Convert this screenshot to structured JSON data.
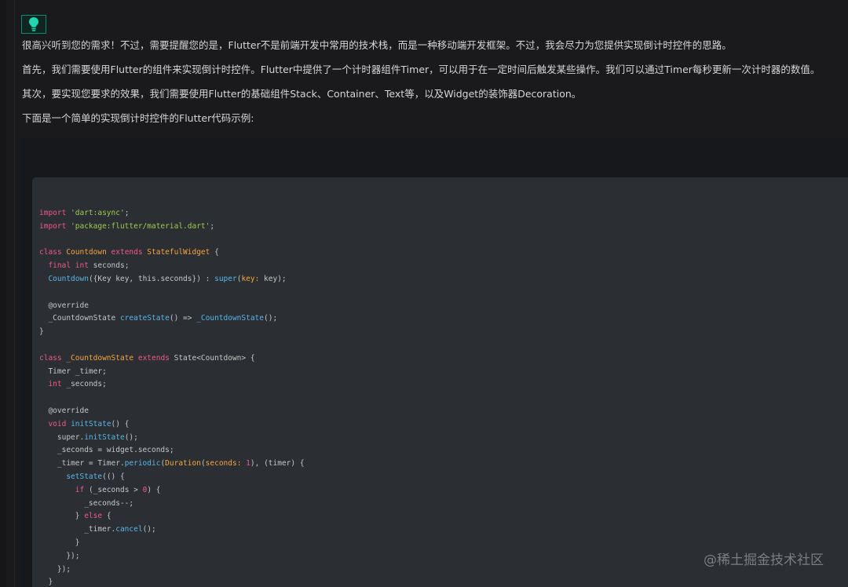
{
  "avatar": {
    "icon": "lightbulb-icon",
    "accent": "#1fd6b0"
  },
  "message": {
    "paragraphs": [
      "很高兴听到您的需求！不过，需要提醒您的是，Flutter不是前端开发中常用的技术栈，而是一种移动端开发框架。不过，我会尽力为您提供实现倒计时控件的思路。",
      "首先，我们需要使用Flutter的组件来实现倒计时控件。Flutter中提供了一个计时器组件Timer，可以用于在一定时间后触发某些操作。我们可以通过Timer每秒更新一次计时器的数值。",
      "其次，要实现您要求的效果，我们需要使用Flutter的基础组件Stack、Container、Text等，以及Widget的装饰器Decoration。",
      "下面是一个简单的实现倒计时控件的Flutter代码示例:"
    ]
  },
  "code": {
    "language": "dart",
    "lines": [
      [
        [
          "kw",
          "import "
        ],
        [
          "str",
          "'dart:async'"
        ],
        [
          "p",
          ";"
        ]
      ],
      [
        [
          "kw",
          "import "
        ],
        [
          "str",
          "'package:flutter/material.dart'"
        ],
        [
          "p",
          ";"
        ]
      ],
      [],
      [
        [
          "kw",
          "class "
        ],
        [
          "type",
          "Countdown "
        ],
        [
          "kw",
          "extends "
        ],
        [
          "type",
          "StatefulWidget"
        ],
        [
          "p",
          " {"
        ]
      ],
      [
        [
          "p",
          "  "
        ],
        [
          "kw",
          "final int"
        ],
        [
          "p",
          " seconds;"
        ]
      ],
      [
        [
          "p",
          "  "
        ],
        [
          "fn",
          "Countdown"
        ],
        [
          "p",
          "({Key key, this.seconds}) : "
        ],
        [
          "fn",
          "super"
        ],
        [
          "p",
          "("
        ],
        [
          "type",
          "key:"
        ],
        [
          "p",
          " key);"
        ]
      ],
      [],
      [
        [
          "p",
          "  @override"
        ]
      ],
      [
        [
          "p",
          "  _CountdownState "
        ],
        [
          "fn",
          "createState"
        ],
        [
          "p",
          "() => "
        ],
        [
          "fn",
          "_CountdownState"
        ],
        [
          "p",
          "();"
        ]
      ],
      [
        [
          "p",
          "}"
        ]
      ],
      [],
      [
        [
          "kw",
          "class "
        ],
        [
          "type",
          "_CountdownState "
        ],
        [
          "kw",
          "extends "
        ],
        [
          "p",
          "State<Countdown> {"
        ]
      ],
      [
        [
          "p",
          "  Timer _timer;"
        ]
      ],
      [
        [
          "p",
          "  "
        ],
        [
          "kw",
          "int"
        ],
        [
          "p",
          " _seconds;"
        ]
      ],
      [],
      [
        [
          "p",
          "  @override"
        ]
      ],
      [
        [
          "p",
          "  "
        ],
        [
          "kw",
          "void "
        ],
        [
          "fn",
          "initState"
        ],
        [
          "p",
          "() {"
        ]
      ],
      [
        [
          "p",
          "    super."
        ],
        [
          "fn",
          "initState"
        ],
        [
          "p",
          "();"
        ]
      ],
      [
        [
          "p",
          "    _seconds = widget.seconds;"
        ]
      ],
      [
        [
          "p",
          "    _timer = Timer."
        ],
        [
          "fn",
          "periodic"
        ],
        [
          "p",
          "("
        ],
        [
          "type",
          "Duration"
        ],
        [
          "p",
          "("
        ],
        [
          "type",
          "seconds:"
        ],
        [
          "p",
          " "
        ],
        [
          "num",
          "1"
        ],
        [
          "p",
          "), (timer) {"
        ]
      ],
      [
        [
          "p",
          "      "
        ],
        [
          "fn",
          "setState"
        ],
        [
          "p",
          "(() {"
        ]
      ],
      [
        [
          "p",
          "        "
        ],
        [
          "kw",
          "if"
        ],
        [
          "p",
          " (_seconds > "
        ],
        [
          "num",
          "0"
        ],
        [
          "p",
          ") {"
        ]
      ],
      [
        [
          "p",
          "          _seconds--;"
        ]
      ],
      [
        [
          "p",
          "        } "
        ],
        [
          "kw",
          "else"
        ],
        [
          "p",
          " {"
        ]
      ],
      [
        [
          "p",
          "          _timer."
        ],
        [
          "fn",
          "cancel"
        ],
        [
          "p",
          "();"
        ]
      ],
      [
        [
          "p",
          "        }"
        ]
      ],
      [
        [
          "p",
          "      });"
        ]
      ],
      [
        [
          "p",
          "    });"
        ]
      ],
      [
        [
          "p",
          "  }"
        ]
      ]
    ]
  },
  "watermark": "@稀土掘金技术社区",
  "colors": {
    "background": "#1a1a1c",
    "text": "#d6d6d6",
    "code_background": "#2b2e33",
    "keyword": "#ef5a87",
    "string": "#9ccc4e",
    "type": "#f7a541",
    "function": "#58b6e8"
  }
}
